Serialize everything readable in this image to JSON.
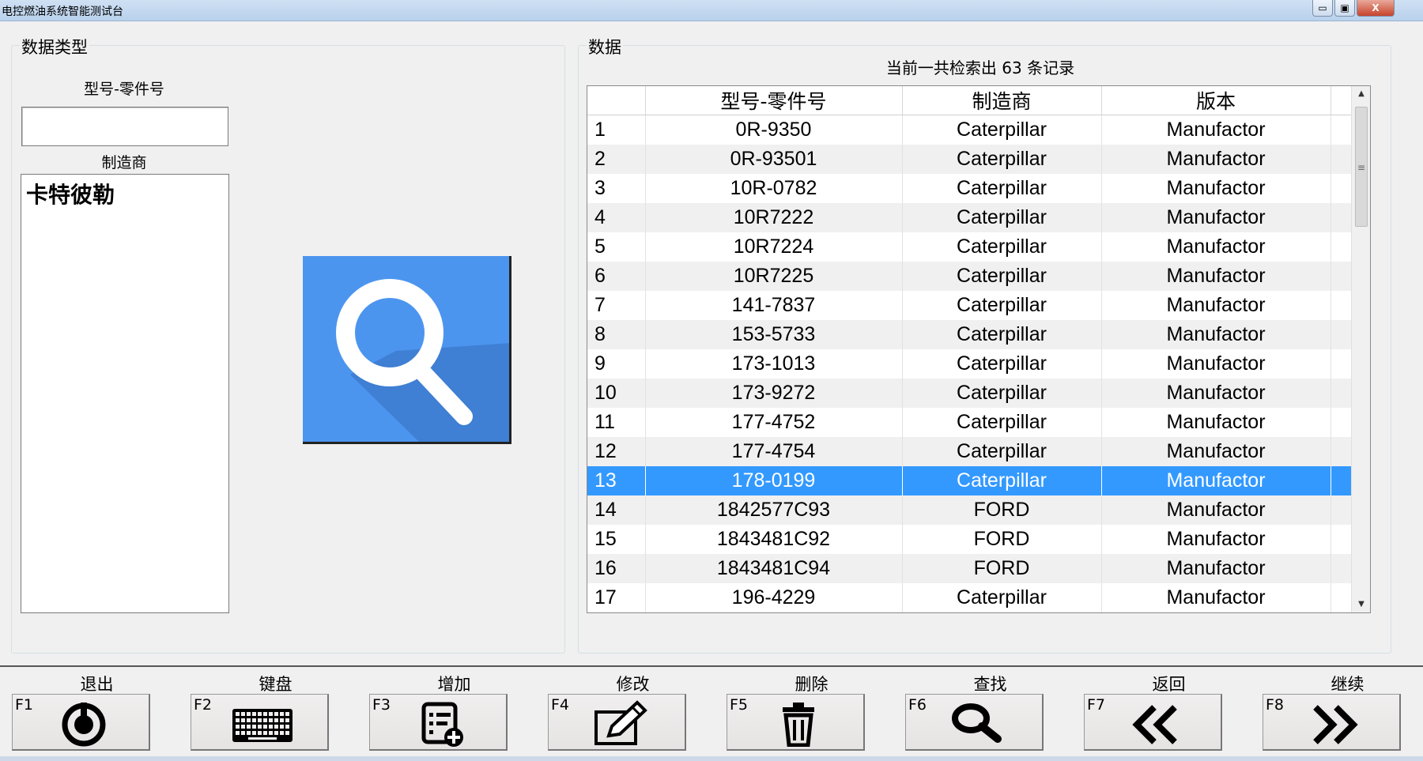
{
  "window": {
    "title": "电控燃油系统智能测试台",
    "min": "▭",
    "max": "▣",
    "close": "X"
  },
  "left_panel": {
    "legend": "数据类型",
    "model_label": "型号-零件号",
    "model_value": "",
    "manufacturer_label": "制造商",
    "manufacturers": [
      "卡特彼勒"
    ]
  },
  "right_panel": {
    "legend": "数据",
    "record_count_text": "当前一共检索出 63 条记录",
    "columns": [
      "",
      "型号-零件号",
      "制造商",
      "版本"
    ],
    "selected_index": 12,
    "rows": [
      [
        "1",
        "0R-9350",
        "Caterpillar",
        "Manufactor"
      ],
      [
        "2",
        "0R-93501",
        "Caterpillar",
        "Manufactor"
      ],
      [
        "3",
        "10R-0782",
        "Caterpillar",
        "Manufactor"
      ],
      [
        "4",
        "10R7222",
        "Caterpillar",
        "Manufactor"
      ],
      [
        "5",
        "10R7224",
        "Caterpillar",
        "Manufactor"
      ],
      [
        "6",
        "10R7225",
        "Caterpillar",
        "Manufactor"
      ],
      [
        "7",
        "141-7837",
        "Caterpillar",
        "Manufactor"
      ],
      [
        "8",
        "153-5733",
        "Caterpillar",
        "Manufactor"
      ],
      [
        "9",
        "173-1013",
        "Caterpillar",
        "Manufactor"
      ],
      [
        "10",
        "173-9272",
        "Caterpillar",
        "Manufactor"
      ],
      [
        "11",
        "177-4752",
        "Caterpillar",
        "Manufactor"
      ],
      [
        "12",
        "177-4754",
        "Caterpillar",
        "Manufactor"
      ],
      [
        "13",
        "178-0199",
        "Caterpillar",
        "Manufactor"
      ],
      [
        "14",
        "1842577C93",
        "FORD",
        "Manufactor"
      ],
      [
        "15",
        "1843481C92",
        "FORD",
        "Manufactor"
      ],
      [
        "16",
        "1843481C94",
        "FORD",
        "Manufactor"
      ],
      [
        "17",
        "196-4229",
        "Caterpillar",
        "Manufactor"
      ]
    ]
  },
  "function_keys": [
    {
      "key": "F1",
      "label": "退出",
      "icon": "power-icon"
    },
    {
      "key": "F2",
      "label": "键盘",
      "icon": "keyboard-icon"
    },
    {
      "key": "F3",
      "label": "增加",
      "icon": "add-list-icon"
    },
    {
      "key": "F4",
      "label": "修改",
      "icon": "edit-icon"
    },
    {
      "key": "F5",
      "label": "删除",
      "icon": "trash-icon"
    },
    {
      "key": "F6",
      "label": "查找",
      "icon": "search-icon"
    },
    {
      "key": "F7",
      "label": "返回",
      "icon": "double-left-icon"
    },
    {
      "key": "F8",
      "label": "继续",
      "icon": "double-right-icon"
    }
  ],
  "colors": {
    "selection": "#3399ff",
    "search_tile": "#4c95ef"
  }
}
